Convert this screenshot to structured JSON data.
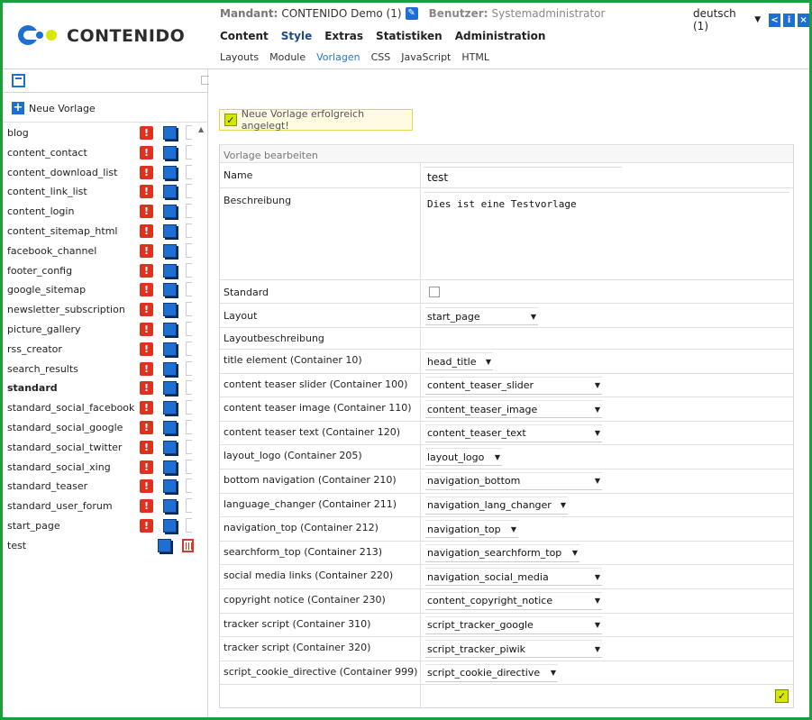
{
  "header": {
    "logo_text": "CONTENIDO",
    "mandant_label": "Mandant:",
    "mandant_value": "CONTENIDO Demo (1)",
    "benutzer_label": "Benutzer:",
    "benutzer_value": "Systemadministrator",
    "language": "deutsch (1)",
    "main_nav": [
      "Content",
      "Style",
      "Extras",
      "Statistiken",
      "Administration"
    ],
    "main_nav_active": "Style",
    "sub_nav": [
      "Layouts",
      "Module",
      "Vorlagen",
      "CSS",
      "JavaScript",
      "HTML"
    ],
    "sub_nav_active": "Vorlagen",
    "header_icons": [
      "share-icon",
      "info-icon",
      "close-icon"
    ]
  },
  "sidebar": {
    "new_template_label": "Neue Vorlage",
    "templates": [
      {
        "name": "blog",
        "bold": false,
        "used": true
      },
      {
        "name": "content_contact",
        "bold": false,
        "used": true
      },
      {
        "name": "content_download_list",
        "bold": false,
        "used": true
      },
      {
        "name": "content_link_list",
        "bold": false,
        "used": true
      },
      {
        "name": "content_login",
        "bold": false,
        "used": true
      },
      {
        "name": "content_sitemap_html",
        "bold": false,
        "used": true
      },
      {
        "name": "facebook_channel",
        "bold": false,
        "used": true
      },
      {
        "name": "footer_config",
        "bold": false,
        "used": true
      },
      {
        "name": "google_sitemap",
        "bold": false,
        "used": true
      },
      {
        "name": "newsletter_subscription",
        "bold": false,
        "used": true
      },
      {
        "name": "picture_gallery",
        "bold": false,
        "used": true
      },
      {
        "name": "rss_creator",
        "bold": false,
        "used": true
      },
      {
        "name": "search_results",
        "bold": false,
        "used": true
      },
      {
        "name": "standard",
        "bold": true,
        "used": true
      },
      {
        "name": "standard_social_facebook",
        "bold": false,
        "used": true
      },
      {
        "name": "standard_social_google",
        "bold": false,
        "used": true
      },
      {
        "name": "standard_social_twitter",
        "bold": false,
        "used": true
      },
      {
        "name": "standard_social_xing",
        "bold": false,
        "used": true
      },
      {
        "name": "standard_teaser",
        "bold": false,
        "used": true
      },
      {
        "name": "standard_user_forum",
        "bold": false,
        "used": true
      },
      {
        "name": "start_page",
        "bold": false,
        "used": true
      },
      {
        "name": "test",
        "bold": false,
        "used": false
      }
    ]
  },
  "main": {
    "success_message": "Neue Vorlage erfolgreich angelegt!",
    "form_title": "Vorlage bearbeiten",
    "name_label": "Name",
    "name_value": "test",
    "description_label": "Beschreibung",
    "description_value": "Dies ist eine Testvorlage",
    "standard_label": "Standard",
    "standard_checked": false,
    "layout_label": "Layout",
    "layout_value": "start_page",
    "layout_description_label": "Layoutbeschreibung",
    "containers": [
      {
        "label": "title element (Container 10)",
        "value": "head_title",
        "width": 75
      },
      {
        "label": "content teaser slider (Container 100)",
        "value": "content_teaser_slider",
        "width": 196
      },
      {
        "label": "content teaser image (Container 110)",
        "value": "content_teaser_image",
        "width": 196
      },
      {
        "label": "content teaser text (Container 120)",
        "value": "content_teaser_text",
        "width": 196
      },
      {
        "label": "layout_logo (Container 205)",
        "value": "layout_logo",
        "width": 85
      },
      {
        "label": "bottom navigation (Container 210)",
        "value": "navigation_bottom",
        "width": 196
      },
      {
        "label": "language_changer (Container 211)",
        "value": "navigation_lang_changer",
        "width": 158
      },
      {
        "label": "navigation_top (Container 212)",
        "value": "navigation_top",
        "width": 103
      },
      {
        "label": "searchform_top (Container 213)",
        "value": "navigation_searchform_top",
        "width": 171
      },
      {
        "label": "social media links (Container 220)",
        "value": "navigation_social_media",
        "width": 196
      },
      {
        "label": "copyright notice (Container 230)",
        "value": "content_copyright_notice",
        "width": 196
      },
      {
        "label": "tracker script (Container 310)",
        "value": "script_tracker_google",
        "width": 196
      },
      {
        "label": "tracker script (Container 320)",
        "value": "script_tracker_piwik",
        "width": 196
      },
      {
        "label": "script_cookie_directive (Container 999)",
        "value": "script_cookie_directive",
        "width": 147
      }
    ]
  },
  "colors": {
    "frame": "#1e9e3a",
    "accent_blue": "#1f6ed1",
    "warning_red": "#e0301e",
    "check_yellow": "#d6e800"
  }
}
